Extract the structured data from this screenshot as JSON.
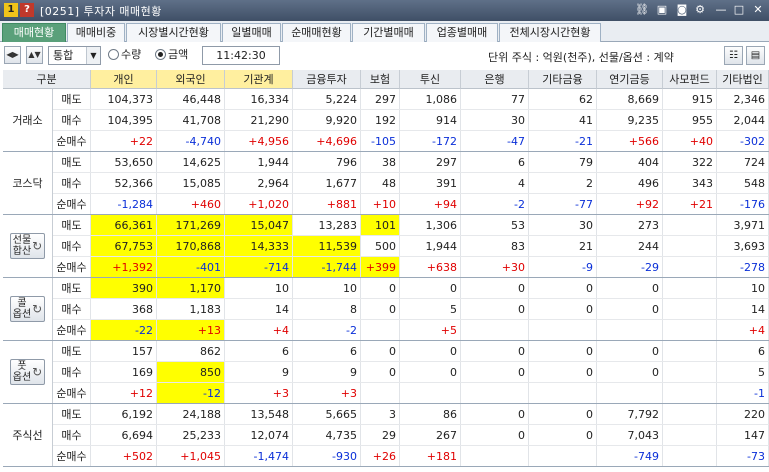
{
  "window": {
    "badge1": "1",
    "badge2": "?",
    "title": "[0251] 투자자 매매현황",
    "icons": [
      "link-icon",
      "save-icon",
      "window-icon",
      "camera-icon",
      "gear-icon",
      "minimize-icon",
      "maximize-icon",
      "close-icon"
    ]
  },
  "tabs": [
    "매매현황",
    "매매비중",
    "시장별시간현황",
    "일별매매",
    "순매매현황",
    "기간별매매",
    "업종별매매",
    "전체시장시간현황"
  ],
  "active_tab": 0,
  "toolbar": {
    "market": "통합",
    "radio_qty": "수량",
    "radio_amount": "금액",
    "selected_radio": "금액",
    "time": "11:42:30",
    "unit_text": "단위 주식 : 억원(천주), 선물/옵션 : 계약"
  },
  "headers": [
    "구분",
    "개인",
    "외국인",
    "기관계",
    "금융투자",
    "보험",
    "투신",
    "은행",
    "기타금융",
    "연기금등",
    "사모펀드",
    "기타법인"
  ],
  "row_labels": [
    "매도",
    "매수",
    "순매수"
  ],
  "groups": [
    {
      "name": "거래소",
      "button": false,
      "rows": [
        [
          "104,373",
          "46,448",
          "16,334",
          "5,224",
          "297",
          "1,086",
          "77",
          "62",
          "8,669",
          "915",
          "2,346"
        ],
        [
          "104,395",
          "41,708",
          "21,290",
          "9,920",
          "192",
          "914",
          "30",
          "41",
          "9,235",
          "955",
          "2,044"
        ],
        [
          "+22",
          "-4,740",
          "+4,956",
          "+4,696",
          "-105",
          "-172",
          "-47",
          "-21",
          "+566",
          "+40",
          "-302"
        ]
      ]
    },
    {
      "name": "코스닥",
      "button": false,
      "rows": [
        [
          "53,650",
          "14,625",
          "1,944",
          "796",
          "38",
          "297",
          "6",
          "79",
          "404",
          "322",
          "724"
        ],
        [
          "52,366",
          "15,085",
          "2,964",
          "1,677",
          "48",
          "391",
          "4",
          "2",
          "496",
          "343",
          "548"
        ],
        [
          "-1,284",
          "+460",
          "+1,020",
          "+881",
          "+10",
          "+94",
          "-2",
          "-77",
          "+92",
          "+21",
          "-176"
        ]
      ]
    },
    {
      "name": "선물\n합산",
      "button": true,
      "rows": [
        [
          "66,361",
          "171,269",
          "15,047",
          "13,283",
          "101",
          "1,306",
          "53",
          "30",
          "273",
          "",
          "3,971"
        ],
        [
          "67,753",
          "170,868",
          "14,333",
          "11,539",
          "500",
          "1,944",
          "83",
          "21",
          "244",
          "",
          "3,693"
        ],
        [
          "+1,392",
          "-401",
          "-714",
          "-1,744",
          "+399",
          "+638",
          "+30",
          "-9",
          "-29",
          "",
          "-278"
        ]
      ]
    },
    {
      "name": "콜\n옵션",
      "button": true,
      "rows": [
        [
          "390",
          "1,170",
          "10",
          "10",
          "0",
          "0",
          "0",
          "0",
          "0",
          "",
          "10"
        ],
        [
          "368",
          "1,183",
          "14",
          "8",
          "0",
          "5",
          "0",
          "0",
          "0",
          "",
          "14"
        ],
        [
          "-22",
          "+13",
          "+4",
          "-2",
          "",
          "+5",
          "",
          "",
          "",
          "",
          "+4"
        ]
      ]
    },
    {
      "name": "풋\n옵션",
      "button": true,
      "rows": [
        [
          "157",
          "862",
          "6",
          "6",
          "0",
          "0",
          "0",
          "0",
          "0",
          "",
          "6"
        ],
        [
          "169",
          "850",
          "9",
          "9",
          "0",
          "0",
          "0",
          "0",
          "0",
          "",
          "5"
        ],
        [
          "+12",
          "-12",
          "+3",
          "+3",
          "",
          "",
          "",
          "",
          "",
          "",
          "-1"
        ]
      ]
    },
    {
      "name": "주식선",
      "button": false,
      "rows": [
        [
          "6,192",
          "24,188",
          "13,548",
          "5,665",
          "3",
          "86",
          "0",
          "0",
          "7,792",
          "",
          "220"
        ],
        [
          "6,694",
          "25,233",
          "12,074",
          "4,735",
          "29",
          "267",
          "0",
          "0",
          "7,043",
          "",
          "147"
        ],
        [
          "+502",
          "+1,045",
          "-1,474",
          "-930",
          "+26",
          "+181",
          "",
          "",
          "-749",
          "",
          "-73"
        ]
      ]
    }
  ],
  "highlights": [
    [
      2,
      0,
      0
    ],
    [
      2,
      0,
      1
    ],
    [
      2,
      0,
      2
    ],
    [
      2,
      0,
      4
    ],
    [
      2,
      1,
      0
    ],
    [
      2,
      1,
      1
    ],
    [
      2,
      1,
      2
    ],
    [
      2,
      1,
      3
    ],
    [
      2,
      2,
      0
    ],
    [
      2,
      2,
      1
    ],
    [
      2,
      2,
      2
    ],
    [
      2,
      2,
      3
    ],
    [
      2,
      2,
      4
    ],
    [
      3,
      0,
      0
    ],
    [
      3,
      0,
      1
    ],
    [
      3,
      2,
      0
    ],
    [
      3,
      2,
      1
    ],
    [
      4,
      1,
      1
    ],
    [
      4,
      2,
      1
    ]
  ],
  "colors": {
    "highlight": "#ffff00",
    "header_highlight": "#ffef9f",
    "up": "#e00000",
    "down": "#0a2fd8",
    "tab_active": "#5aa07a"
  }
}
